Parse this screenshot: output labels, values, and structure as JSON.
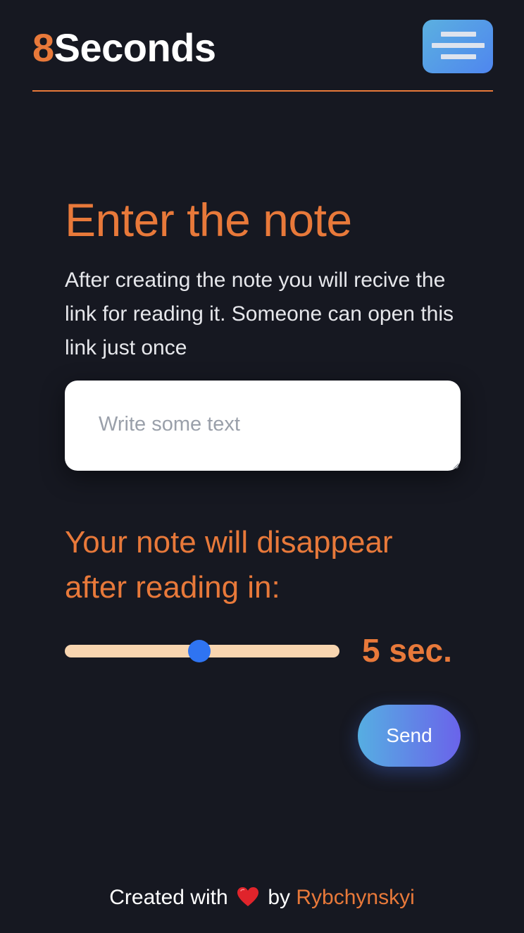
{
  "header": {
    "logo_number": "8",
    "logo_text": "Seconds",
    "menu_icon": "hamburger-menu-icon"
  },
  "main": {
    "title": "Enter the note",
    "description": "After creating the note you will recive the link for reading it. Someone can open this link just once",
    "note_input": {
      "value": "",
      "placeholder": "Write some text"
    },
    "disappear_label": "Your note will disappear after reading in:",
    "timer": {
      "value": 5,
      "min": 1,
      "max": 10,
      "value_label": "5 sec."
    },
    "send_label": "Send"
  },
  "footer": {
    "prefix": "Created with",
    "heart_icon": "heart-icon",
    "by": "by",
    "author": "Rybchynskyi"
  },
  "colors": {
    "background": "#161821",
    "accent": "#e8793a",
    "slider_track": "#f8d5b0",
    "slider_thumb": "#2f74f2",
    "button_gradient_start": "#56aee2",
    "button_gradient_end": "#6a63ea"
  }
}
